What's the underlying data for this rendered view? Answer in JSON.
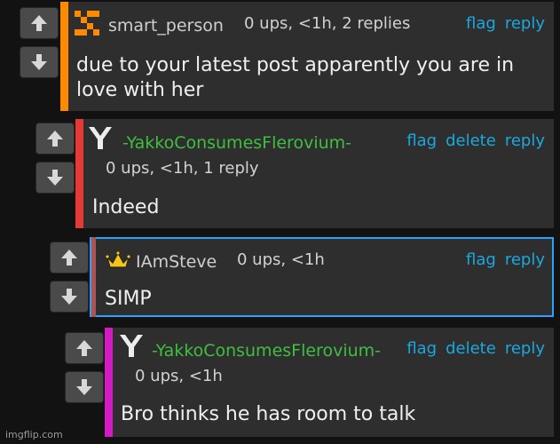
{
  "comments": [
    {
      "username": "smart_person",
      "username_color": "#cfcfcf",
      "bar_color": "#ff8a00",
      "avatar_icon": "orange-pixel-avatar-icon",
      "meta": "0 ups, <1h, 2 replies",
      "actions": [
        "flag",
        "reply"
      ],
      "text": "due to your latest post apparently you are in love with her"
    },
    {
      "username": "-YakkoConsumesFlerovium-",
      "username_color": "#3fbf3f",
      "bar_color": "#e53935",
      "avatar_icon": "white-y-avatar-icon",
      "meta": "0 ups, <1h, 1 reply",
      "actions": [
        "flag",
        "delete",
        "reply"
      ],
      "text": "Indeed"
    },
    {
      "username": "IAmSteve",
      "username_color": "#cfcfcf",
      "bar_color": "#2aa3ff",
      "avatar_icon": "crown-avatar-icon",
      "meta": "0 ups, <1h",
      "actions": [
        "flag",
        "reply"
      ],
      "text": "SIMP"
    },
    {
      "username": "-YakkoConsumesFlerovium-",
      "username_color": "#3fbf3f",
      "bar_color": "#d31bc2",
      "avatar_icon": "white-y-avatar-icon",
      "meta": "0 ups, <1h",
      "actions": [
        "flag",
        "delete",
        "reply"
      ],
      "text": "Bro thinks he has room to talk"
    }
  ],
  "action_color": "#1ba8e0",
  "watermark": "imgflip.com"
}
